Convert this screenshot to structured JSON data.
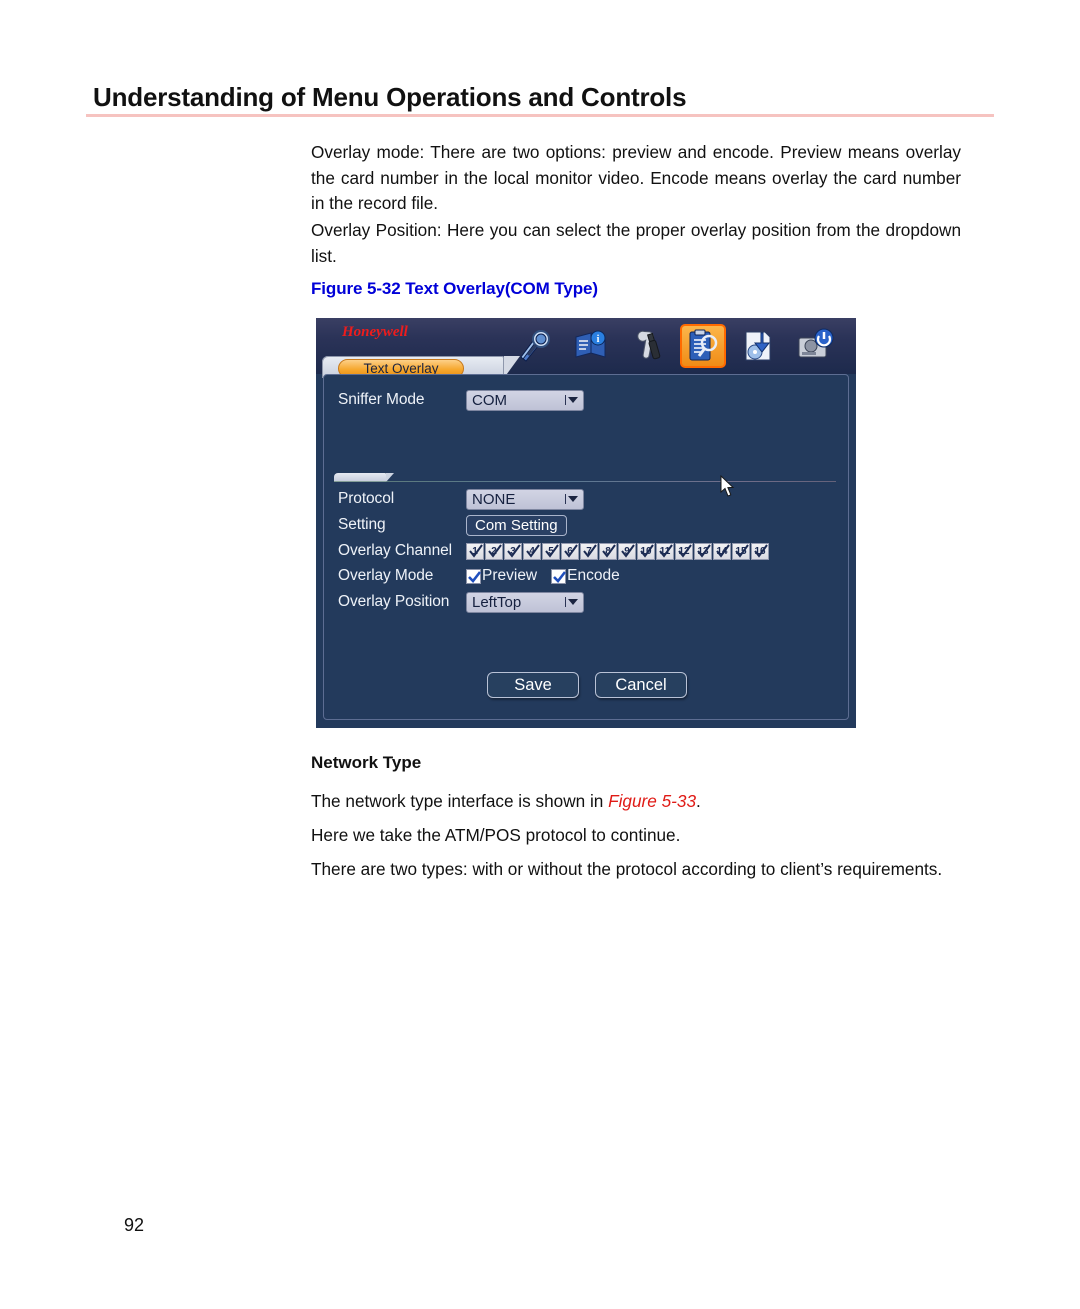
{
  "page": {
    "title": "Understanding of Menu Operations and Controls",
    "number": "92"
  },
  "body": {
    "paragraph_1": "Overlay mode: There are two options: preview and encode. Preview means overlay the card number in the local monitor video. Encode means overlay the card number in the record file.",
    "paragraph_2": "Overlay Position: Here you can select the proper overlay position from the dropdown list.",
    "figure_caption": "Figure 5-32 Text Overlay(COM Type)",
    "subheading": "Network Type",
    "paragraph_3_prefix": "The network type interface is shown in ",
    "paragraph_3_ref": "Figure 5-33",
    "paragraph_3_suffix": ".",
    "paragraph_4": "Here we take the ATM/POS protocol to continue.",
    "paragraph_5": "There are two types: with or without the protocol according to client’s requirements."
  },
  "figure": {
    "brand": "Honeywell",
    "tab_label": "Text Overlay",
    "toolbar_icons": [
      "search-magnifier-icon",
      "info-book-icon",
      "tools-wrench-icon",
      "log-clipboard-search-icon",
      "backup-disc-icon",
      "shutdown-hdd-icon"
    ],
    "toolbar_selected_index": 3,
    "fields": {
      "sniffer_mode": {
        "label": "Sniffer Mode",
        "value": "COM"
      },
      "protocol": {
        "label": "Protocol",
        "value": "NONE"
      },
      "setting": {
        "label": "Setting",
        "button": "Com Setting"
      },
      "overlay_channel": {
        "label": "Overlay Channel",
        "channels": [
          "1",
          "2",
          "3",
          "4",
          "5",
          "6",
          "7",
          "8",
          "9",
          "10",
          "11",
          "12",
          "13",
          "14",
          "15",
          "16"
        ],
        "all_checked": true
      },
      "overlay_mode": {
        "label": "Overlay Mode",
        "options": [
          {
            "label": "Preview",
            "checked": true
          },
          {
            "label": "Encode",
            "checked": true
          }
        ]
      },
      "overlay_position": {
        "label": "Overlay Position",
        "value": "LeftTop"
      }
    },
    "buttons": {
      "save": "Save",
      "cancel": "Cancel"
    }
  },
  "colors": {
    "panel_bg": "#233a5c",
    "accent_orange": "#f3a02a",
    "brand_red": "#ee1c1c",
    "caption_blue": "#0000d8",
    "figure_ref_red": "#e01b16",
    "header_rule": "#f6c3c0"
  }
}
